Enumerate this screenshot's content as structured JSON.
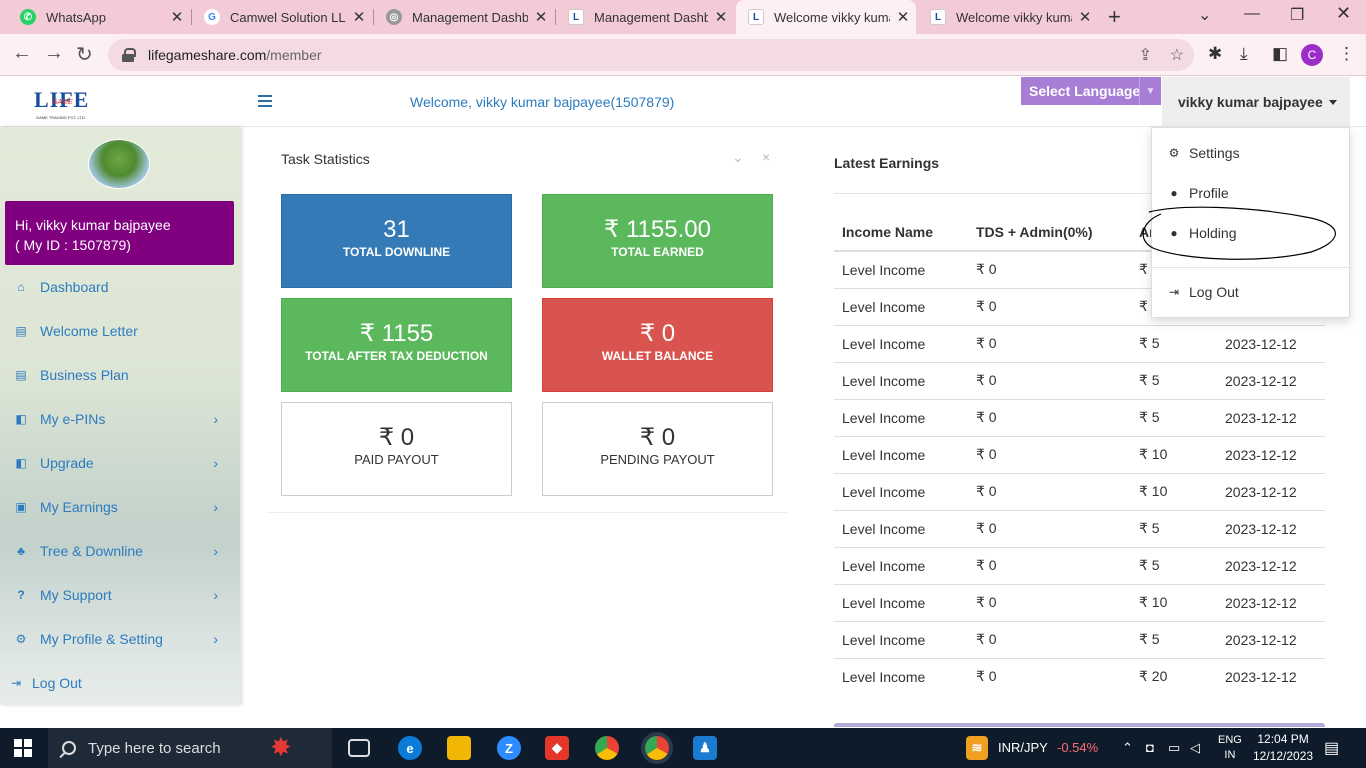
{
  "browser": {
    "tabs": [
      {
        "label": "WhatsApp",
        "icon": "whatsapp-icon"
      },
      {
        "label": "Camwel Solution LLP",
        "icon": "google-icon"
      },
      {
        "label": "Management Dashbo",
        "icon": "globe-icon"
      },
      {
        "label": "Management Dashbo",
        "icon": "lifegame-icon"
      },
      {
        "label": "Welcome vikky kuma",
        "icon": "lifegame-icon"
      },
      {
        "label": "Welcome vikky kuma",
        "icon": "lifegame-icon"
      }
    ],
    "url_host": "lifegameshare.com",
    "url_path": "/member",
    "profile_initial": "C"
  },
  "header": {
    "logo_text": "LIFE",
    "logo_sub": "GAME",
    "logo_tagline": "GAME TRADING PVT. LTD.",
    "welcome": "Welcome, vikky kumar bajpayee(1507879)",
    "language_label": "Select Language",
    "language_arrow": "▼",
    "user_name": "vikky kumar bajpayee"
  },
  "sidebar": {
    "greeting": "Hi, vikky kumar bajpayee",
    "user_id": "( My ID : 1507879)",
    "items": [
      {
        "label": "Dashboard",
        "icon": "home-icon",
        "glyph": "⌂",
        "submenu": false
      },
      {
        "label": "Welcome Letter",
        "icon": "document-icon",
        "glyph": "▤",
        "submenu": false
      },
      {
        "label": "Business Plan",
        "icon": "document-icon",
        "glyph": "▤",
        "submenu": false
      },
      {
        "label": "My e-PINs",
        "icon": "pin-icon",
        "glyph": "◧",
        "submenu": true
      },
      {
        "label": "Upgrade",
        "icon": "upgrade-icon",
        "glyph": "◧",
        "submenu": true
      },
      {
        "label": "My Earnings",
        "icon": "money-icon",
        "glyph": "▣",
        "submenu": true
      },
      {
        "label": "Tree & Downline",
        "icon": "sitemap-icon",
        "glyph": "♣",
        "submenu": true
      },
      {
        "label": "My Support",
        "icon": "question-icon",
        "glyph": "?",
        "submenu": true
      },
      {
        "label": "My Profile & Setting",
        "icon": "gear-icon",
        "glyph": "⚙",
        "submenu": true
      },
      {
        "label": "Log Out",
        "icon": "logout-icon",
        "glyph": "⇥",
        "submenu": false
      }
    ],
    "chevron": "›"
  },
  "task_stats": {
    "title": "Task Statistics",
    "collapse_glyph": "⌄",
    "close_glyph": "×",
    "cards": [
      {
        "value": "31",
        "label": "TOTAL DOWNLINE",
        "style": "blue"
      },
      {
        "value": "₹ 1155.00",
        "label": "TOTAL EARNED",
        "style": "green"
      },
      {
        "value": "₹ 1155",
        "label": "TOTAL AFTER TAX DEDUCTION",
        "style": "green"
      },
      {
        "value": "₹ 0",
        "label": "WALLET BALANCE",
        "style": "red"
      },
      {
        "value": "₹ 0",
        "label": "PAID PAYOUT",
        "style": "white"
      },
      {
        "value": "₹ 0",
        "label": "PENDING PAYOUT",
        "style": "white"
      }
    ]
  },
  "earnings": {
    "title": "Latest Earnings",
    "columns": [
      "Income Name",
      "TDS + Admin(0%)",
      "Ar",
      ""
    ],
    "rows": [
      [
        "Level Income",
        "₹ 0",
        "₹",
        ""
      ],
      [
        "Level Income",
        "₹ 0",
        "₹",
        ""
      ],
      [
        "Level Income",
        "₹ 0",
        "₹ 5",
        "2023-12-12"
      ],
      [
        "Level Income",
        "₹ 0",
        "₹ 5",
        "2023-12-12"
      ],
      [
        "Level Income",
        "₹ 0",
        "₹ 5",
        "2023-12-12"
      ],
      [
        "Level Income",
        "₹ 0",
        "₹ 10",
        "2023-12-12"
      ],
      [
        "Level Income",
        "₹ 0",
        "₹ 10",
        "2023-12-12"
      ],
      [
        "Level Income",
        "₹ 0",
        "₹ 5",
        "2023-12-12"
      ],
      [
        "Level Income",
        "₹ 0",
        "₹ 5",
        "2023-12-12"
      ],
      [
        "Level Income",
        "₹ 0",
        "₹ 10",
        "2023-12-12"
      ],
      [
        "Level Income",
        "₹ 0",
        "₹ 5",
        "2023-12-12"
      ],
      [
        "Level Income",
        "₹ 0",
        "₹ 20",
        "2023-12-12"
      ]
    ]
  },
  "user_dropdown": {
    "items": [
      {
        "label": "Settings",
        "icon": "gear-icon",
        "glyph": "⚙"
      },
      {
        "label": "Profile",
        "icon": "user-icon",
        "glyph": "●"
      },
      {
        "label": "Holding",
        "icon": "user-icon",
        "glyph": "●"
      },
      {
        "label": "Log Out",
        "icon": "logout-icon",
        "glyph": "⇥"
      }
    ]
  },
  "taskbar": {
    "search_placeholder": "Type here to search",
    "ticker": "INR/JPY",
    "ticker_change": "-0.54%",
    "ticker_change_color": "#ff6b6b",
    "lang_line1": "ENG",
    "lang_line2": "IN",
    "time": "12:04 PM",
    "date": "12/12/2023"
  },
  "colors": {
    "purple_box": "#800080",
    "link_blue": "#2d7bbf",
    "tab_bar": "#f3cbd6",
    "language_button": "#a77dd6"
  }
}
